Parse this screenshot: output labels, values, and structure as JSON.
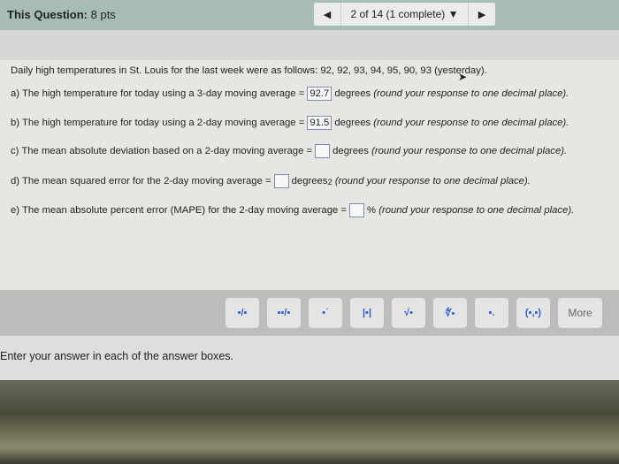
{
  "header": {
    "label": "This Question:",
    "points": "8 pts",
    "nav_prev_icon": "triangle-left-icon",
    "nav_status": "2 of 14 (1 complete)",
    "nav_dropdown_icon": "triangle-down-icon",
    "nav_next_icon": "triangle-right-icon"
  },
  "question": {
    "intro": "Daily high temperatures in St. Louis for the last week were as follows: 92, 92, 93, 94, 95, 90, 93 (yesterday).",
    "parts": [
      {
        "pre": "a) The high temperature for today using a 3-day moving average =",
        "value": "92.7",
        "post": "degrees",
        "note": "(round your response to one decimal place)."
      },
      {
        "pre": "b) The high temperature for today using a 2-day moving average =",
        "value": "91.5",
        "post": "degrees",
        "note": "(round your response to one decimal place)."
      },
      {
        "pre": "c) The mean absolute deviation based on a 2-day moving average =",
        "value": "",
        "post": "degrees",
        "note": "(round your response to one decimal place)."
      },
      {
        "pre": "d) The mean squared error for the 2-day moving average =",
        "value": "",
        "post": "degrees",
        "sup": "2",
        "note": "(round your response to one decimal place)."
      },
      {
        "pre": "e) The mean absolute percent error (MAPE) for the 2-day moving average =",
        "value": "",
        "post": "%",
        "note": "(round your response to one decimal place)."
      }
    ]
  },
  "toolbar": {
    "buttons": [
      {
        "name": "fraction-icon",
        "glyph": "▪/▪"
      },
      {
        "name": "mixed-number-icon",
        "glyph": "▪▪/▪"
      },
      {
        "name": "exponent-icon",
        "glyph": "▪˙"
      },
      {
        "name": "absolute-value-icon",
        "glyph": "|▪|"
      },
      {
        "name": "square-root-icon",
        "glyph": "√▪"
      },
      {
        "name": "nth-root-icon",
        "glyph": "∜▪"
      },
      {
        "name": "subscript-icon",
        "glyph": "▪."
      },
      {
        "name": "ordered-pair-icon",
        "glyph": "(▪,▪)"
      }
    ],
    "more_label": "More"
  },
  "footer": {
    "instruction": "Enter your answer in each of the answer boxes."
  }
}
